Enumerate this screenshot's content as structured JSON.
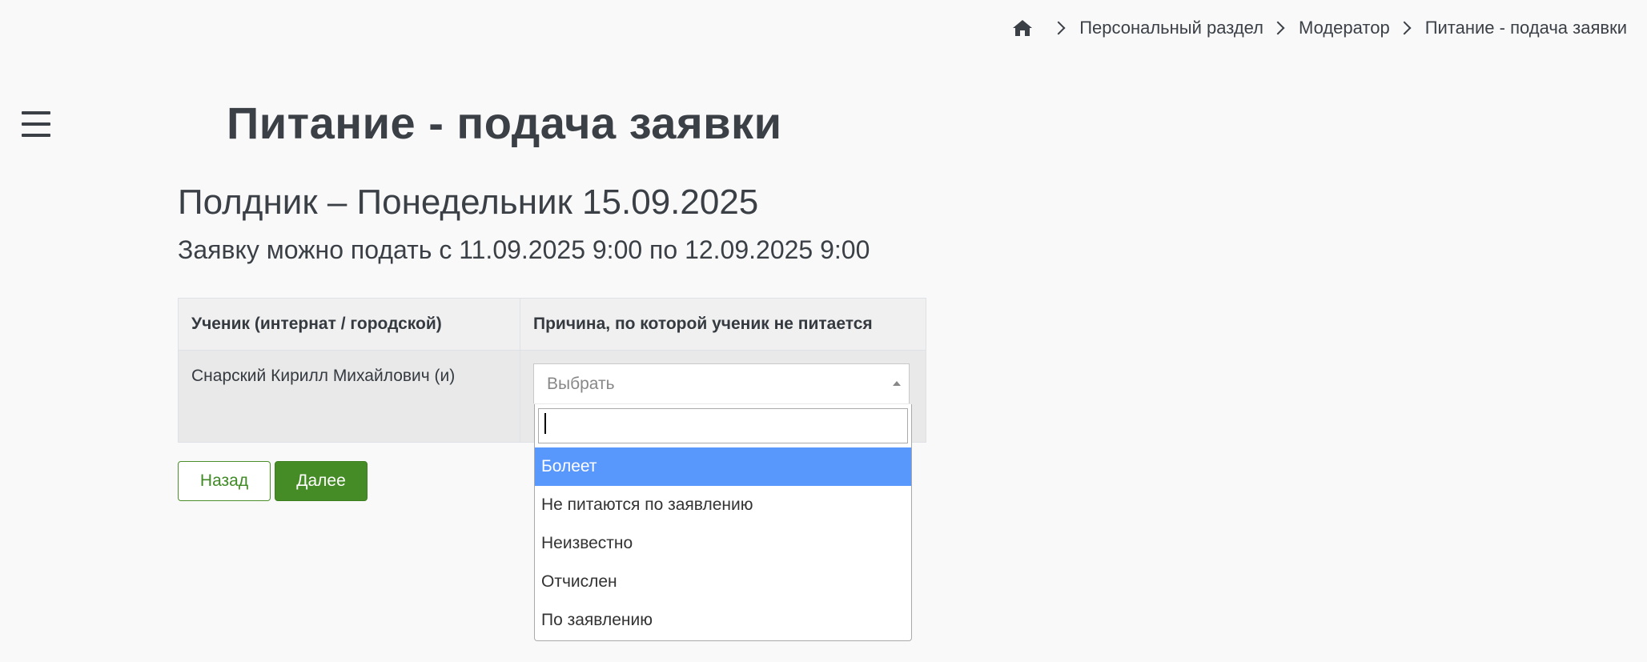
{
  "breadcrumb": {
    "items": [
      "Персональный раздел",
      "Модератор",
      "Питание - подача заявки"
    ]
  },
  "page": {
    "title": "Питание - подача заявки",
    "meal_heading": "Полдник – Понедельник 15.09.2025",
    "period_text": "Заявку можно подать с 11.09.2025 9:00 по 12.09.2025 9:00"
  },
  "table": {
    "headers": [
      "Ученик (интернат / городской)",
      "Причина, по которой ученик не питается"
    ],
    "rows": [
      {
        "student": "Снарский Кирилл Михайлович (и)",
        "reason_placeholder": "Выбрать"
      }
    ]
  },
  "dropdown": {
    "search_value": "",
    "options": [
      "Болеет",
      "Не питаются по заявлению",
      "Неизвестно",
      "Отчислен",
      "По заявлению"
    ],
    "highlighted": "Болеет"
  },
  "buttons": {
    "back_label": "Назад",
    "next_label": "Далее"
  },
  "colors": {
    "accent_green": "#468c26",
    "highlight_blue": "#5897fb"
  },
  "icons": {
    "home": "home-icon",
    "menu": "hamburger-menu-icon"
  }
}
